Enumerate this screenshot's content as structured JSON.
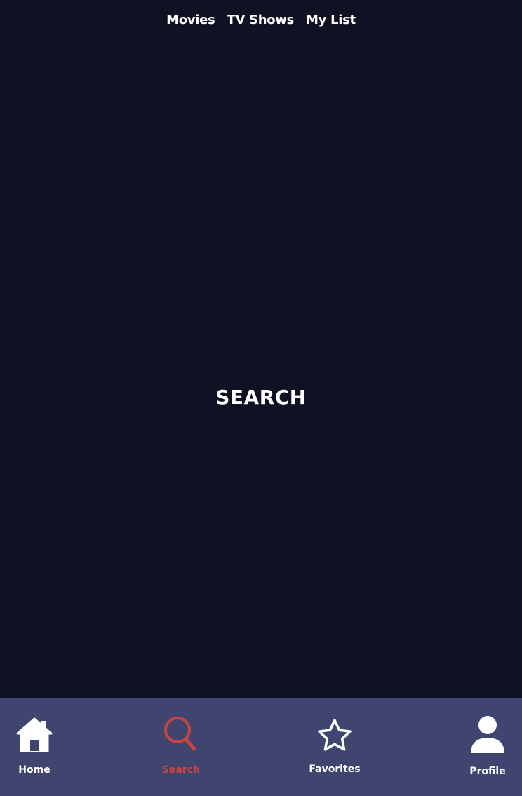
{
  "top_nav": {
    "movies": "Movies",
    "tv_shows": "TV Shows",
    "my_list": "My List"
  },
  "page": {
    "title": "SEARCH"
  },
  "tab_bar": {
    "items": [
      {
        "label": "Home",
        "icon": "home-icon",
        "active": false
      },
      {
        "label": "Search",
        "icon": "search-icon",
        "active": true
      },
      {
        "label": "Favorites",
        "icon": "star-icon",
        "active": false
      },
      {
        "label": "Profile",
        "icon": "user-icon",
        "active": false
      }
    ]
  },
  "colors": {
    "background": "#101224",
    "tab_bar": "#404570",
    "accent": "#c8453d",
    "text": "#ffffff"
  }
}
